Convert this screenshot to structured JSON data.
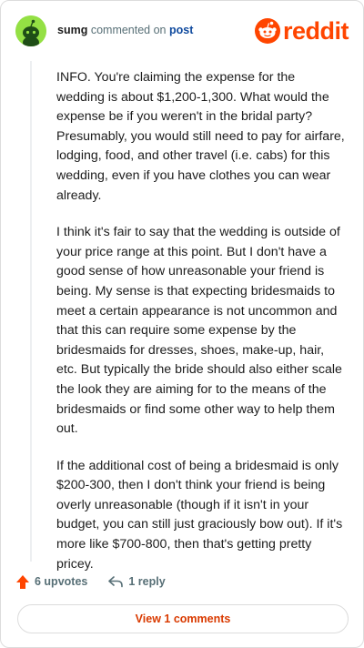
{
  "header": {
    "username": "sumg",
    "commented_on": "commented on",
    "post_link": "post",
    "logo_text": "reddit",
    "avatar_icon": "snoo-avatar-icon",
    "avatar_color": "#94e044",
    "brand_color": "#ff4500"
  },
  "comment": {
    "paragraphs": [
      "INFO. You're claiming the expense for the wedding is about $1,200-1,300. What would the expense be if you weren't in the bridal party? Presumably, you would still need to pay for airfare, lodging, food, and other travel (i.e. cabs) for this wedding, even if you have clothes you can wear already.",
      "I think it's fair to say that the wedding is outside of your price range at this point. But I don't have a good sense of how unreasonable your friend is being. My sense is that expecting bridesmaids to meet a certain appearance is not uncommon and that this can require some expense by the bridesmaids for dresses, shoes, make-up, hair, etc. But typically the bride should also either scale the look they are aiming for to the means of the bridesmaids or find some other way to help them out.",
      "If the additional cost of being a bridesmaid is only $200-300, then I don't think your friend is being overly unreasonable (though if it isn't in your budget, you can still just graciously bow out). If it's more like $700-800, then that's getting pretty pricey."
    ]
  },
  "actions": {
    "upvotes": "6 upvotes",
    "reply": "1 reply",
    "upvote_icon": "upvote-arrow-icon",
    "reply_icon": "reply-arrow-icon"
  },
  "footer": {
    "view_comments": "View 1 comments"
  }
}
